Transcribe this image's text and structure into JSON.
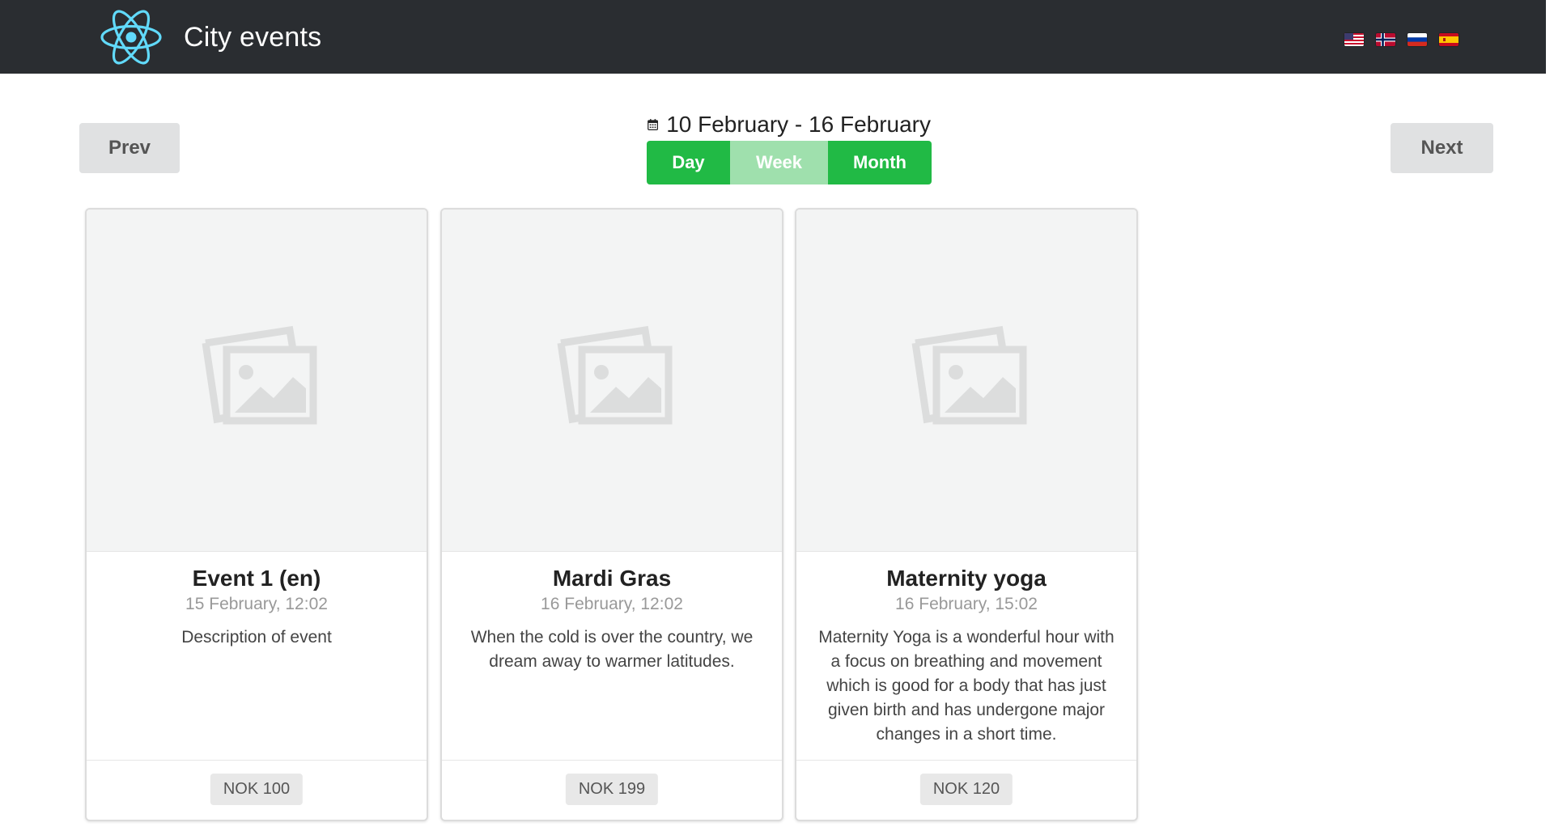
{
  "header": {
    "brand": "City events",
    "languages": [
      {
        "name": "English",
        "icon": "us-flag-icon"
      },
      {
        "name": "Norwegian",
        "icon": "norway-flag-icon"
      },
      {
        "name": "Russian",
        "icon": "russia-flag-icon"
      },
      {
        "name": "Spanish",
        "icon": "spain-flag-icon"
      }
    ]
  },
  "nav": {
    "prev_label": "Prev",
    "next_label": "Next",
    "date_range": "10 February - 16 February",
    "views": {
      "day": "Day",
      "week": "Week",
      "month": "Month",
      "active": "Week"
    }
  },
  "events": [
    {
      "title": "Event 1 (en)",
      "date": "15 February, 12:02",
      "description": "Description of event",
      "price": "NOK 100"
    },
    {
      "title": "Mardi Gras",
      "date": "16 February, 12:02",
      "description": "When the cold is over the country, we dream away to warmer latitudes.",
      "price": "NOK 199"
    },
    {
      "title": "Maternity yoga",
      "date": "16 February, 15:02",
      "description": "Maternity Yoga is a wonderful hour with a focus on breathing and movement which is good for a body that has just given birth and has undergone major changes in a short time.",
      "price": "NOK 120"
    }
  ],
  "colors": {
    "header_bg": "#2a2d31",
    "accent_green": "#21ba45",
    "inactive_green": "#9fe0ad",
    "logo": "#61dafb"
  }
}
